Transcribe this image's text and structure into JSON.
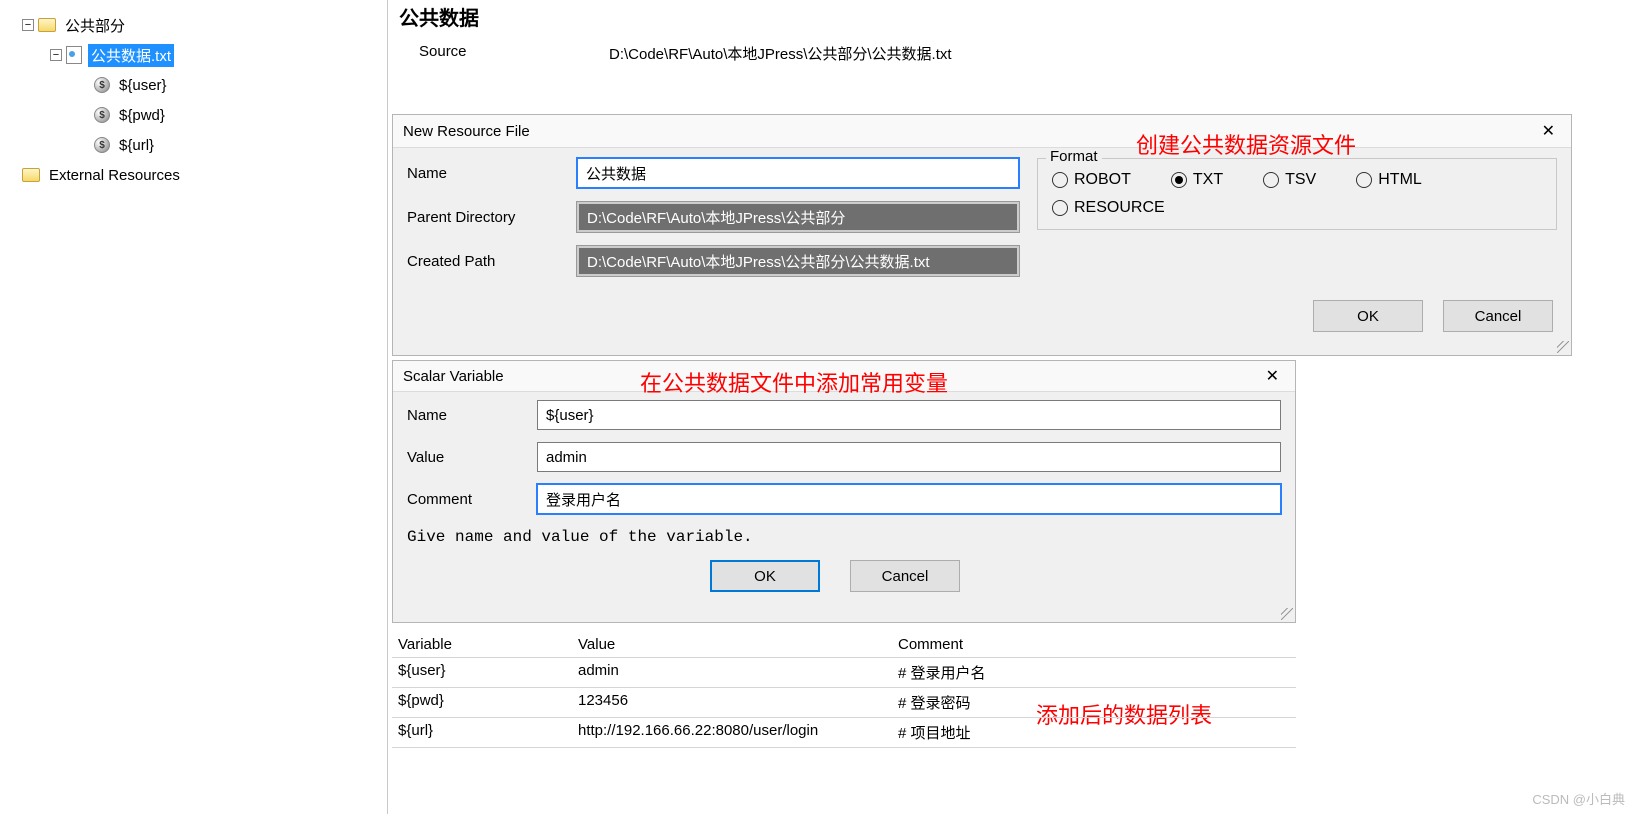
{
  "tree": {
    "public_part": "公共部分",
    "public_data_txt": "公共数据.txt",
    "var_user": "${user}",
    "var_pwd": "${pwd}",
    "var_url": "${url}",
    "external_resources": "External Resources",
    "toggle_minus": "−"
  },
  "header": {
    "title": "公共数据",
    "source_label": "Source",
    "source_value": "D:\\Code\\RF\\Auto\\本地JPress\\公共部分\\公共数据.txt"
  },
  "dlg1": {
    "title": "New Resource File",
    "name_label": "Name",
    "name_value": "公共数据",
    "parent_dir_label": "Parent Directory",
    "parent_dir_value": "D:\\Code\\RF\\Auto\\本地JPress\\公共部分",
    "created_path_label": "Created Path",
    "created_path_value": "D:\\Code\\RF\\Auto\\本地JPress\\公共部分\\公共数据.txt",
    "format_label": "Format",
    "format_robot": "ROBOT",
    "format_txt": "TXT",
    "format_tsv": "TSV",
    "format_html": "HTML",
    "format_resource": "RESOURCE",
    "ok": "OK",
    "cancel": "Cancel",
    "close": "✕"
  },
  "dlg2": {
    "title": "Scalar Variable",
    "name_label": "Name",
    "name_value": "${user}",
    "value_label": "Value",
    "value_value": "admin",
    "comment_label": "Comment",
    "comment_value": "登录用户名",
    "hint": "Give name and value of the variable.",
    "ok": "OK",
    "cancel": "Cancel",
    "close": "✕"
  },
  "annotations": {
    "a1": "创建公共数据资源文件",
    "a2": "在公共数据文件中添加常用变量",
    "a3": "添加后的数据列表"
  },
  "table": {
    "h_variable": "Variable",
    "h_value": "Value",
    "h_comment": "Comment",
    "rows": [
      {
        "var": "${user}",
        "val": "admin",
        "cmt": "# 登录用户名"
      },
      {
        "var": "${pwd}",
        "val": "123456",
        "cmt": "# 登录密码"
      },
      {
        "var": "${url}",
        "val": "http://192.166.66.22:8080/user/login",
        "cmt": "# 项目地址"
      }
    ]
  },
  "watermark": "CSDN @小白典"
}
